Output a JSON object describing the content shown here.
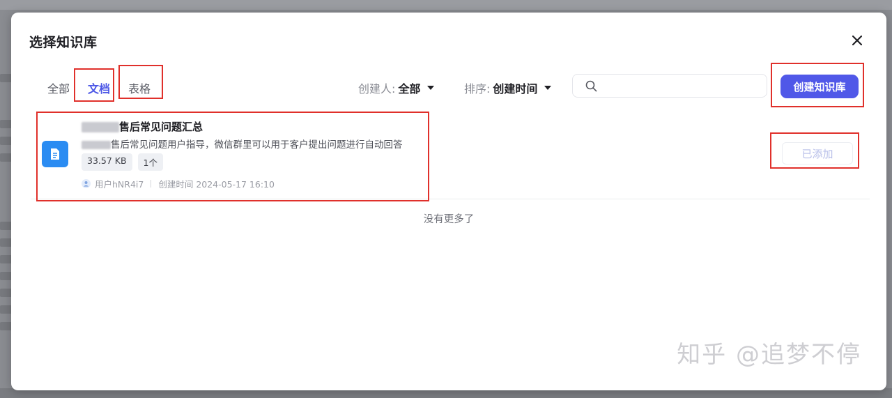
{
  "modal": {
    "title": "选择知识库"
  },
  "tabs": [
    {
      "label": "全部",
      "active": false
    },
    {
      "label": "文档",
      "active": true
    },
    {
      "label": "表格",
      "active": false
    }
  ],
  "filters": {
    "creator_label": "创建人:",
    "creator_value": "全部",
    "sort_label": "排序:",
    "sort_value": "创建时间"
  },
  "search": {
    "placeholder": "",
    "value": ""
  },
  "create_button": "创建知识库",
  "item": {
    "title": "售后常见问题汇总",
    "description": "售后常见问题用户指导，微信群里可以用于客户提出问题进行自动回答",
    "size_tag": "33.57 KB",
    "count_tag": "1个",
    "user": "用户hNR4i7",
    "created": "创建时间 2024-05-17 16:10",
    "status_button": "已添加"
  },
  "list_end": "没有更多了",
  "watermark": "知乎 @追梦不停",
  "colors": {
    "accent": "#5058e8",
    "active_tab": "#4b56e6",
    "doc_icon": "#2b8cf2",
    "annotation": "#e0302b"
  }
}
